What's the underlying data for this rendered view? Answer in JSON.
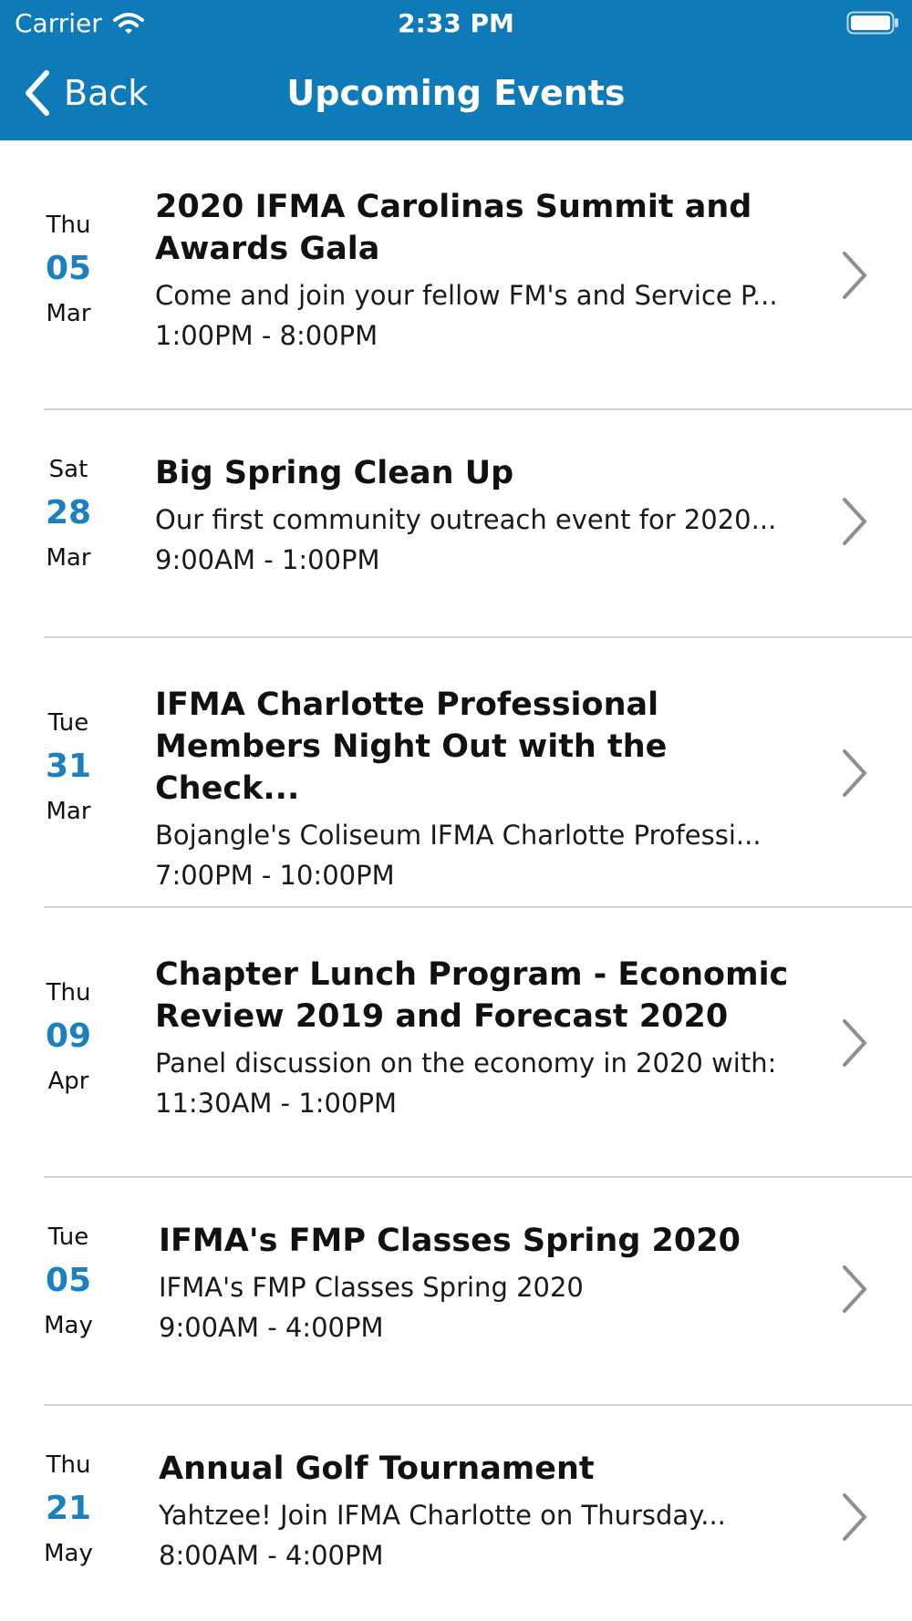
{
  "status_bar": {
    "carrier": "Carrier",
    "time": "2:33 PM",
    "wifi_icon": "wifi-icon",
    "battery_icon": "battery-icon"
  },
  "nav": {
    "back_label": "Back",
    "back_icon": "chevron-left-icon",
    "title": "Upcoming Events"
  },
  "colors": {
    "nav_background": "#0f7ab8",
    "date_accent": "#1a80c0",
    "divider": "#d2d2d6",
    "chevron": "#8e8e93"
  },
  "events": [
    {
      "dow": "Thu",
      "day": "05",
      "month": "Mar",
      "title": "2020 IFMA Carolinas Summit and Awards Gala",
      "description": "Come and join your fellow FM's and Service P...",
      "time": "1:00PM - 8:00PM"
    },
    {
      "dow": "Sat",
      "day": "28",
      "month": "Mar",
      "title": "Big Spring Clean Up",
      "description": "Our first community outreach event for 2020...",
      "time": "9:00AM - 1:00PM"
    },
    {
      "dow": "Tue",
      "day": "31",
      "month": "Mar",
      "title": "IFMA Charlotte Professional Members Night Out with the Check...",
      "description": "Bojangle's Coliseum  IFMA Charlotte Professi...",
      "time": "7:00PM - 10:00PM"
    },
    {
      "dow": "Thu",
      "day": "09",
      "month": "Apr",
      "title": "Chapter Lunch Program - Economic Review 2019 and Forecast 2020",
      "description": "Panel discussion on the economy in 2020 with:",
      "time": "11:30AM - 1:00PM"
    },
    {
      "dow": "Tue",
      "day": "05",
      "month": "May",
      "title": "IFMA's FMP Classes Spring 2020",
      "description": "IFMA's FMP Classes Spring 2020",
      "time": "9:00AM - 4:00PM"
    },
    {
      "dow": "Thu",
      "day": "21",
      "month": "May",
      "title": "Annual Golf Tournament",
      "description": "Yahtzee!   Join IFMA Charlotte on Thursday...",
      "time": "8:00AM - 4:00PM"
    }
  ]
}
